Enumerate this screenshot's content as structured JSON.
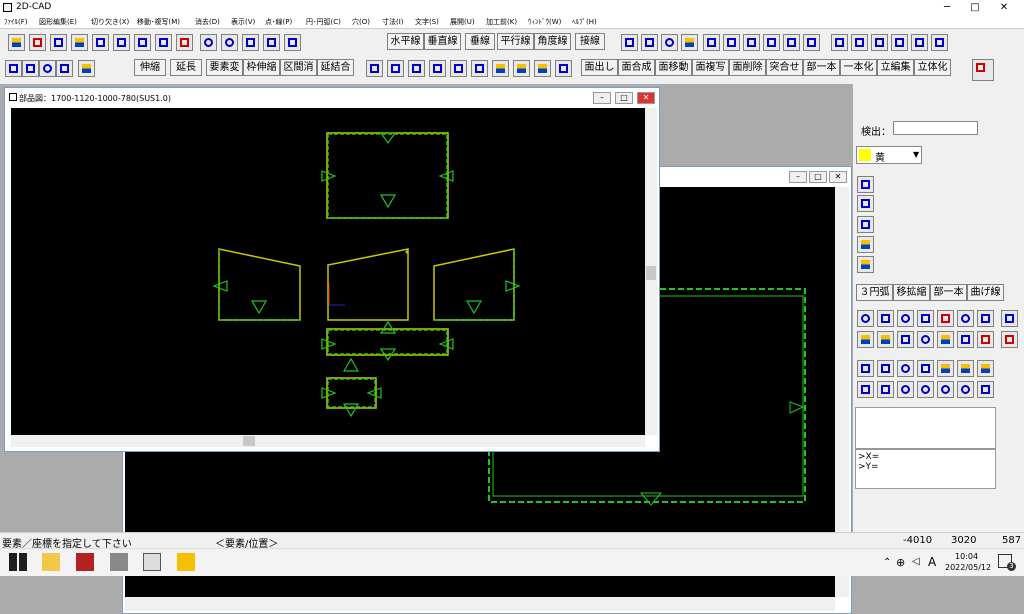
{
  "app": {
    "title": "2D-CAD"
  },
  "window_controls": {
    "minimize": "─",
    "maximize": "□",
    "close": "✕"
  },
  "menu": [
    "ﾌｧｲﾙ(F)",
    "図形編集(E)",
    "切り欠き(X)",
    "移動･複写(M)",
    "消去(D)",
    "表示(V)",
    "点･線(P)",
    "円･円弧(C)",
    "穴(O)",
    "寸法(I)",
    "文字(S)",
    "展開(U)",
    "加工前(K)",
    "ｳｨﾝﾄﾞｳ(W)",
    "ﾍﾙﾌﾟ(H)"
  ],
  "toolbar_row1_text": [
    "水平線",
    "垂直線",
    "垂線",
    "平行線",
    "角度線",
    "接線"
  ],
  "toolbar_row2_text": [
    "伸縮",
    "延長",
    "要素変",
    "枠伸縮",
    "区間消",
    "延結合"
  ],
  "toolbar_row2_right": [
    "面出し",
    "面合成",
    "面移動",
    "面複写",
    "面削除",
    "突合せ",
    "部一本",
    "一本化",
    "立編集",
    "立体化"
  ],
  "right_panel": {
    "search_label": "検出：",
    "search_value": "",
    "color_value": "黄",
    "color_hex": "#ffff00",
    "tabs": [
      "３円弧",
      "移拡縮",
      "部一本",
      "曲げ線"
    ],
    "coord_x": ">X=",
    "coord_y": ">Y="
  },
  "front_window": {
    "title": "部品図：1700-1120-1000-780(SUS1.0)"
  },
  "status": {
    "prompt": "要素／座標を指定して下さい",
    "mode": "＜要素/位置＞",
    "x": "-4010",
    "y": "3020",
    "z": "587"
  },
  "taskbar": {
    "time": "10:04",
    "date": "2022/05/12",
    "ime": "A",
    "notif": "3"
  }
}
